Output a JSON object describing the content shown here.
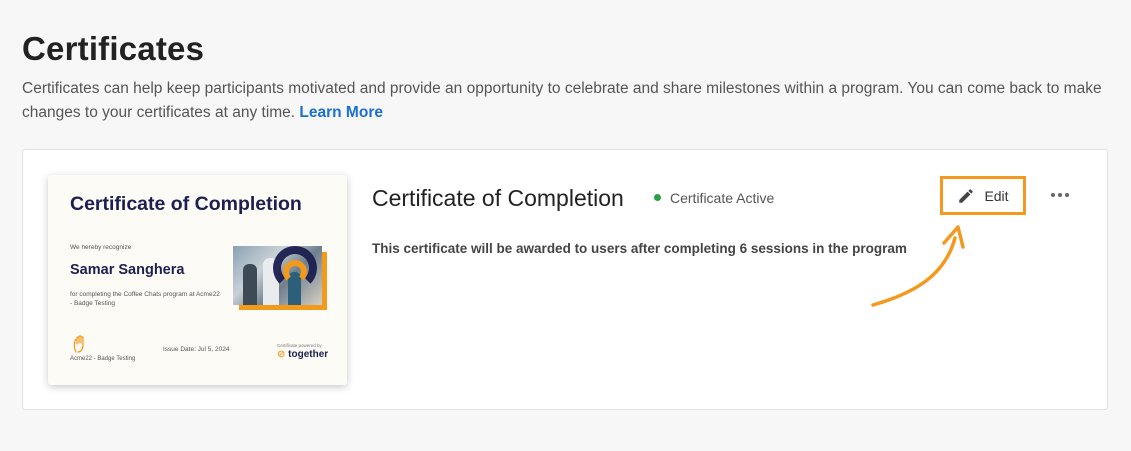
{
  "header": {
    "title": "Certificates",
    "description": "Certificates can help keep participants motivated and provide an opportunity to celebrate and share milestones within a program. You can come back to make changes to your certificates at any time.",
    "learn_more": "Learn More"
  },
  "certificate": {
    "title": "Certificate of Completion",
    "status": "Certificate Active",
    "status_color": "#2e9e4a",
    "description": "This certificate will be awarded to users after completing 6 sessions in the program",
    "edit_label": "Edit",
    "highlight_color": "#f39a1e",
    "preview": {
      "title": "Certificate of Completion",
      "recognize": "We hereby recognize",
      "recipient": "Samar Sanghera",
      "for_text": "for completing the Coffee Chats program at Acme22 - Badge Testing",
      "org": "Acme22 - Badge Testing",
      "issue_date": "Issue Date: Jul 5, 2024",
      "powered_by": "Certificate powered by",
      "brand": "together"
    }
  },
  "icons": {
    "edit": "pencil-icon",
    "more": "more-horizontal-icon",
    "logo": "hand-logo-icon"
  }
}
